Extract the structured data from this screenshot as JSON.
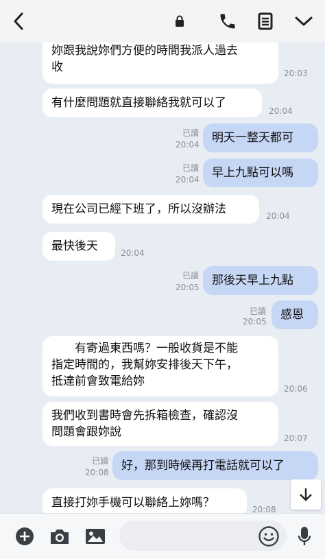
{
  "colors": {
    "outgoing": "#c6d7f5",
    "incoming": "#ffffff",
    "background": "#e7edf3"
  },
  "header": {
    "icons": [
      "back-arrow-icon",
      "lock-icon",
      "phone-icon",
      "notes-icon",
      "chevron-down-icon"
    ]
  },
  "messages": [
    {
      "dir": "in",
      "text": "妳跟我說妳們方便的時間我派人過去\n收",
      "time": "20:03"
    },
    {
      "dir": "in",
      "text": "有什麼問題就直接聯絡我就可以了",
      "time": "20:04"
    },
    {
      "dir": "out",
      "text": "明天一整天都可",
      "read": "已讀",
      "time": "20:04"
    },
    {
      "dir": "out",
      "text": "早上九點可以嗎",
      "read": "已讀",
      "time": "20:04"
    },
    {
      "dir": "in",
      "text": "現在公司已經下班了，所以沒辦法",
      "time": "20:04"
    },
    {
      "dir": "in",
      "text": "最快後天",
      "time": "20:04"
    },
    {
      "dir": "out",
      "text": "那後天早上九點",
      "read": "已讀",
      "time": "20:05"
    },
    {
      "dir": "out",
      "text": "感恩",
      "read": "已讀",
      "time": "20:05"
    },
    {
      "dir": "in",
      "text": "　　有寄過東西嗎？一般收貨是不能\n指定時間的，我幫妳安排後天下午，\n抵達前會致電給妳",
      "time": "20:06"
    },
    {
      "dir": "in",
      "text": "我們收到書時會先拆箱檢查，確認沒\n問題會跟妳說",
      "time": "20:07"
    },
    {
      "dir": "out",
      "text": "好，那到時候再打電話就可以了",
      "read": "已讀",
      "time": "20:08"
    },
    {
      "dir": "in",
      "text": "直接打妳手機可以聯絡上妳嗎？",
      "time": "20:08"
    }
  ],
  "bottom": {
    "icons": [
      "plus-icon",
      "camera-icon",
      "image-icon",
      "emoji-icon",
      "microphone-icon"
    ]
  }
}
